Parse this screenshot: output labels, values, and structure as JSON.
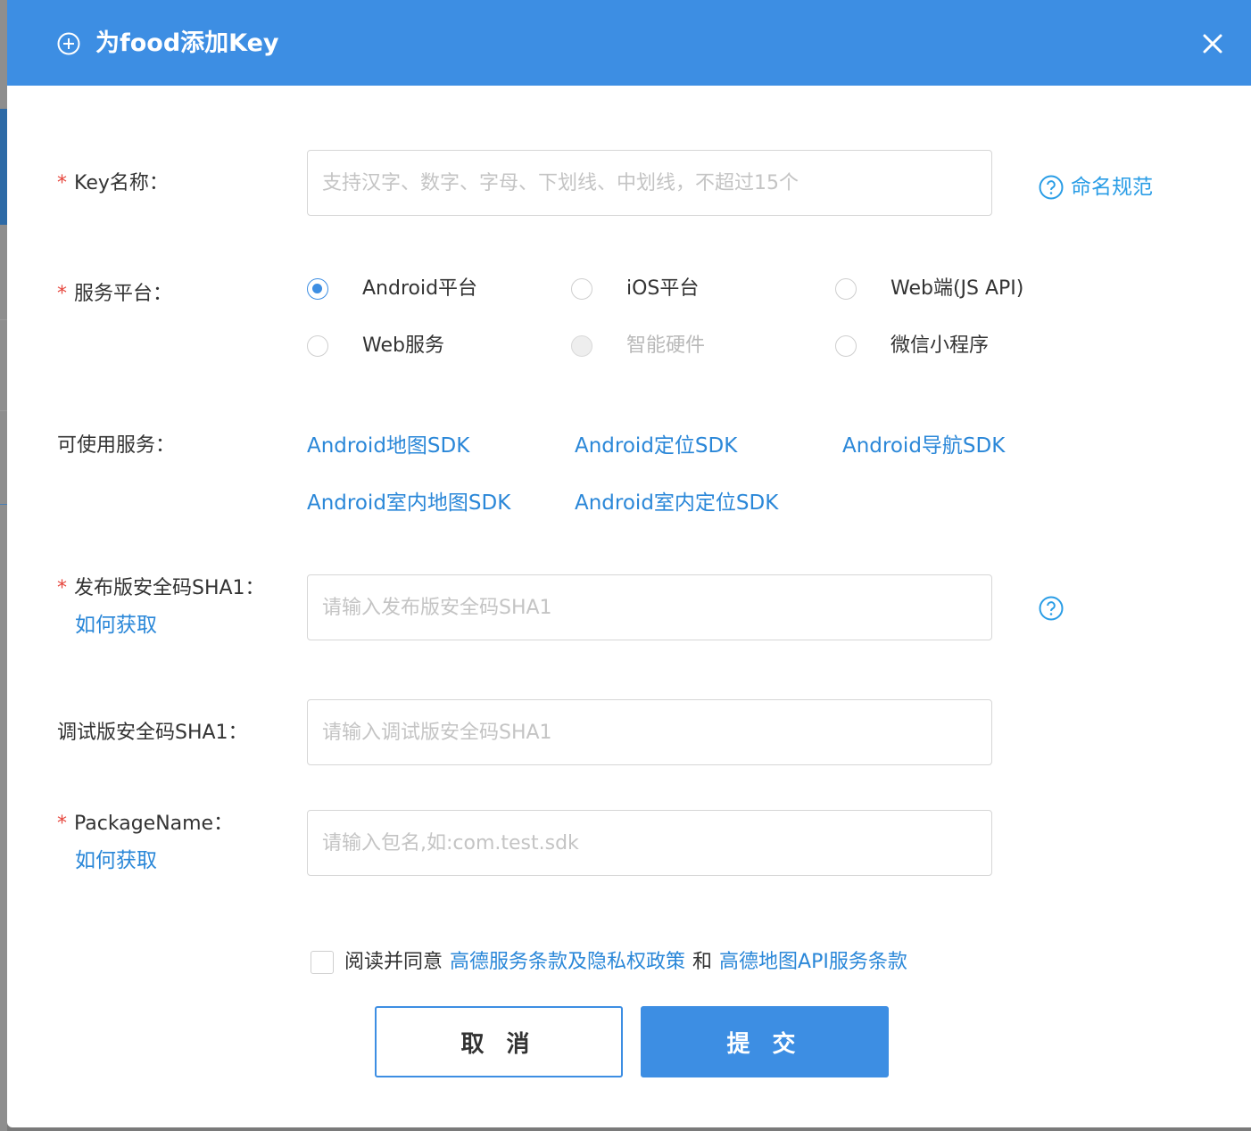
{
  "dialog": {
    "title": "为food添加Key",
    "close_icon": "close-icon",
    "header_color": "#3d8ee3"
  },
  "key_name": {
    "label": "Key名称：",
    "placeholder": "支持汉字、数字、字母、下划线、中划线，不超过15个",
    "value": "",
    "help_text": "命名规范"
  },
  "platform": {
    "label": "服务平台：",
    "options": [
      {
        "label": "Android平台",
        "checked": true,
        "disabled": false
      },
      {
        "label": "iOS平台",
        "checked": false,
        "disabled": false
      },
      {
        "label": "Web端(JS API)",
        "checked": false,
        "disabled": false
      },
      {
        "label": "Web服务",
        "checked": false,
        "disabled": false
      },
      {
        "label": "智能硬件",
        "checked": false,
        "disabled": true
      },
      {
        "label": "微信小程序",
        "checked": false,
        "disabled": false
      }
    ]
  },
  "services": {
    "label": "可使用服务：",
    "items": [
      "Android地图SDK",
      "Android定位SDK",
      "Android导航SDK",
      "Android室内地图SDK",
      "Android室内定位SDK"
    ]
  },
  "release_sha1": {
    "label": "发布版安全码SHA1：",
    "how_link": "如何获取",
    "placeholder": "请输入发布版安全码SHA1",
    "value": ""
  },
  "debug_sha1": {
    "label": "调试版安全码SHA1：",
    "placeholder": "请输入调试版安全码SHA1",
    "value": ""
  },
  "package_name": {
    "label": "PackageName：",
    "how_link": "如何获取",
    "placeholder": "请输入包名,如:com.test.sdk",
    "value": ""
  },
  "agreement": {
    "checked": false,
    "prefix": "阅读并同意",
    "link1": "高德服务条款及隐私权政策",
    "middle": "和",
    "link2": "高德地图API服务条款"
  },
  "buttons": {
    "cancel": "取 消",
    "submit": "提 交"
  },
  "required_mark": "*"
}
